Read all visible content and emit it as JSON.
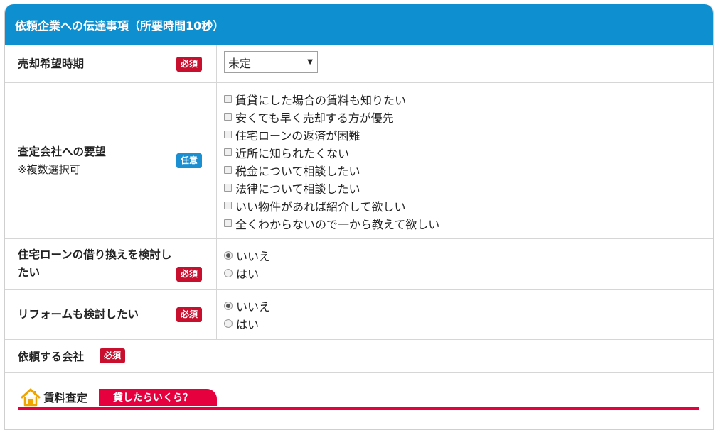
{
  "header": {
    "title": "依頼企業への伝達事項（所要時間10秒）"
  },
  "badges": {
    "required": "必須",
    "optional": "任意"
  },
  "rows": {
    "sale_timing": {
      "label": "売却希望時期",
      "select_value": "未定"
    },
    "requests": {
      "label": "査定会社への要望",
      "sublabel": "※複数選択可",
      "options": [
        "賃貸にした場合の賃料も知りたい",
        "安くても早く売却する方が優先",
        "住宅ローンの返済が困難",
        "近所に知られたくない",
        "税金について相談したい",
        "法律について相談したい",
        "いい物件があれば紹介して欲しい",
        "全くわからないので一から教えて欲しい"
      ]
    },
    "refinance": {
      "label_line1": "住宅ローンの借り換えを検討し",
      "label_line2": "たい",
      "options": [
        "いいえ",
        "はい"
      ],
      "selected": "いいえ"
    },
    "reform": {
      "label": "リフォームも検討したい",
      "options": [
        "いいえ",
        "はい"
      ],
      "selected": "いいえ"
    },
    "company": {
      "label": "依頼する会社"
    }
  },
  "rental": {
    "icon": "house-icon",
    "title": "賃料査定",
    "tab_label": "貸したらいくら？"
  },
  "colors": {
    "header": "#0e8fd0",
    "required": "#c8102e",
    "optional": "#1a8fd2",
    "accent": "#e6003e"
  }
}
